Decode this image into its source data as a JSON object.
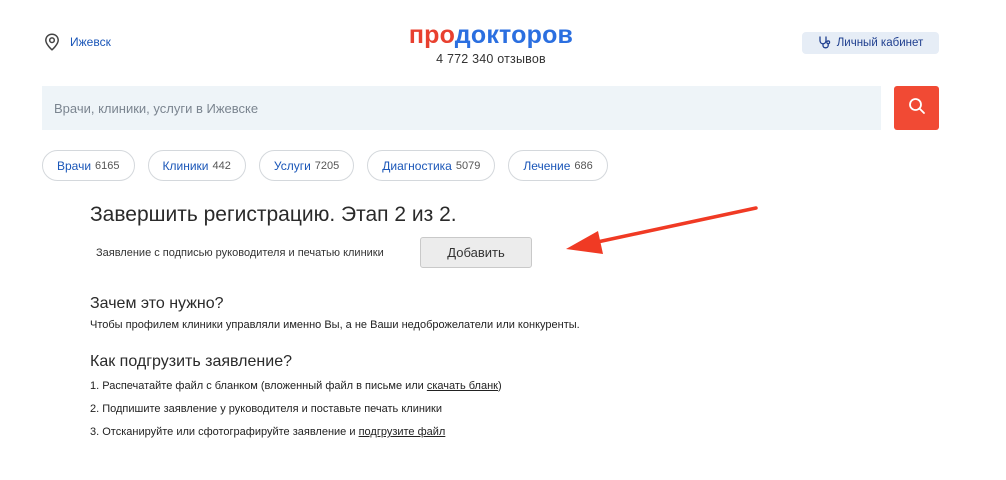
{
  "header": {
    "city": "Ижевск",
    "logo_part1": "про",
    "logo_part2": "докторов",
    "reviews": "4 772 340 отзывов",
    "cabinet": "Личный кабинет"
  },
  "search": {
    "placeholder": "Врачи, клиники, услуги в Ижевске"
  },
  "chips": [
    {
      "label": "Врачи",
      "count": "6165"
    },
    {
      "label": "Клиники",
      "count": "442"
    },
    {
      "label": "Услуги",
      "count": "7205"
    },
    {
      "label": "Диагностика",
      "count": "5079"
    },
    {
      "label": "Лечение",
      "count": "686"
    }
  ],
  "registration": {
    "title": "Завершить регистрацию. Этап 2 из 2.",
    "document_label": "Заявление с подписью руководителя и печатью клиники",
    "add_button": "Добавить",
    "why_title": "Зачем это нужно?",
    "why_text": "Чтобы профилем клиники управляли именно Вы, а не Ваши недоброжелатели или конкуренты.",
    "how_title": "Как подгрузить заявление?",
    "step1_text": "1. Распечатайте файл с бланком (вложенный файл в письме или ",
    "step1_link": "скачать бланк",
    "step1_end": ")",
    "step2_text": "2. Подпишите заявление у руководителя и поставьте печать клиники",
    "step3_text": "3. Отсканируйте или сфотографируйте заявление и ",
    "step3_link": "подгрузите файл"
  },
  "colors": {
    "brand_red": "#e8402f",
    "brand_blue": "#2b6fe0",
    "search_button": "#f14a34",
    "annotation_arrow": "#f03a24"
  },
  "icons": {
    "location": "location-pin-icon",
    "cabinet": "stethoscope-icon",
    "search": "search-icon"
  }
}
